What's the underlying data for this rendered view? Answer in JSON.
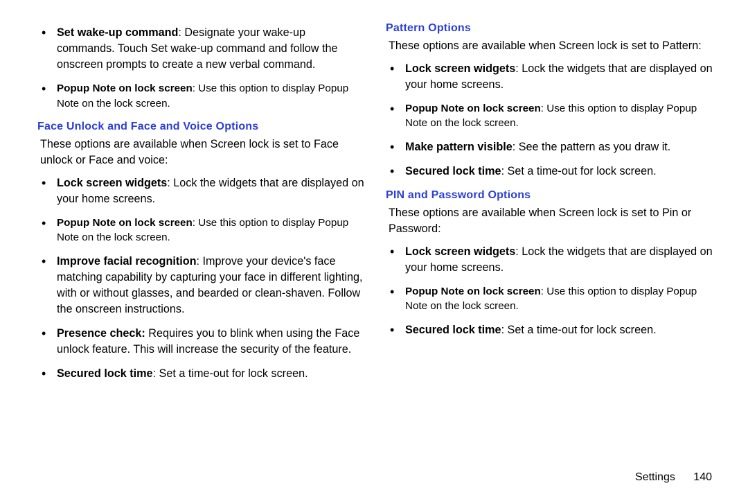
{
  "leftCol": {
    "bullets1": [
      {
        "lead": "Set wake-up command",
        "rest": ": Designate your wake-up commands. Touch Set wake-up command and follow the onscreen prompts to create a new verbal command.",
        "small": false
      },
      {
        "lead": "Popup Note on lock screen",
        "rest": ": Use this option to display Popup Note on the lock screen.",
        "small": true
      }
    ],
    "section": {
      "title": "Face Unlock and Face and Voice Options",
      "intro": "These options are available when Screen lock is set to Face unlock or Face and voice:",
      "bullets": [
        {
          "lead": "Lock screen widgets",
          "rest": ": Lock the widgets that are displayed on your home screens.",
          "small": false
        },
        {
          "lead": "Popup Note on lock screen",
          "rest": ": Use this option to display Popup Note on the lock screen.",
          "small": true
        },
        {
          "lead": "Improve facial recognition",
          "rest": ": Improve your device's face matching capability by capturing your face in different lighting, with or without glasses, and bearded or clean-shaven. Follow the onscreen instructions.",
          "small": false
        },
        {
          "lead": "Presence check:",
          "rest": " Requires you to blink when using the Face unlock feature. This will increase the security of the feature.",
          "small": false
        },
        {
          "lead": "Secured lock time",
          "rest": ": Set a time-out for lock screen.",
          "small": false
        }
      ]
    }
  },
  "rightCol": {
    "section1": {
      "title": "Pattern Options",
      "intro": "These options are available when Screen lock is set to Pattern:",
      "bullets": [
        {
          "lead": "Lock screen widgets",
          "rest": ": Lock the widgets that are displayed on your home screens.",
          "small": false
        },
        {
          "lead": "Popup Note on lock screen",
          "rest": ": Use this option to display Popup Note on the lock screen.",
          "small": true
        },
        {
          "lead": "Make pattern visible",
          "rest": ": See the pattern as you draw it.",
          "small": false
        },
        {
          "lead": "Secured lock time",
          "rest": ": Set a time-out for lock screen.",
          "small": false
        }
      ]
    },
    "section2": {
      "title": "PIN and Password Options",
      "intro": "These options are available when Screen lock is set to Pin or Password:",
      "bullets": [
        {
          "lead": "Lock screen widgets",
          "rest": ": Lock the widgets that are displayed on your home screens.",
          "small": false
        },
        {
          "lead": "Popup Note on lock screen",
          "rest": ": Use this option to display Popup Note on the lock screen.",
          "small": true
        },
        {
          "lead": "Secured lock time",
          "rest": ": Set a time-out for lock screen.",
          "small": false
        }
      ]
    }
  },
  "footer": {
    "section": "Settings",
    "page": "140"
  }
}
